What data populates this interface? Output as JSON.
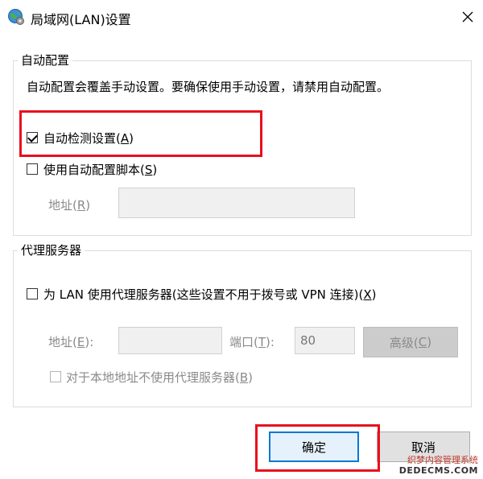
{
  "window": {
    "title": "局域网(LAN)设置",
    "icon": "globe-settings-icon"
  },
  "auto_config": {
    "legend": "自动配置",
    "description": "自动配置会覆盖手动设置。要确保使用手动设置，请禁用自动配置。",
    "auto_detect": {
      "prefix": "自动检测设置(",
      "key": "A",
      "suffix": ")",
      "checked": true
    },
    "use_script": {
      "prefix": "使用自动配置脚本(",
      "key": "S",
      "suffix": ")",
      "checked": false
    },
    "address": {
      "prefix": "地址(",
      "key": "R",
      "suffix": ")",
      "value": ""
    }
  },
  "proxy": {
    "legend": "代理服务器",
    "use_proxy": {
      "prefix": "为 LAN 使用代理服务器(这些设置不用于拨号或 VPN 连接)(",
      "key": "X",
      "suffix": ")",
      "checked": false
    },
    "address": {
      "prefix": "地址(",
      "key": "E",
      "suffix": "):",
      "value": ""
    },
    "port": {
      "prefix": "端口(",
      "key": "T",
      "suffix": "):",
      "value": "80"
    },
    "advanced": {
      "prefix": "高级(",
      "key": "C",
      "suffix": ")"
    },
    "bypass_local": {
      "prefix": "对于本地地址不使用代理服务器(",
      "key": "B",
      "suffix": ")",
      "checked": false
    }
  },
  "buttons": {
    "ok": "确定",
    "cancel": "取消"
  },
  "watermark": {
    "line1": "织梦内容管理系统",
    "line2": "DEDECMS.COM"
  },
  "colors": {
    "highlight": "#e8101e",
    "ok_border": "#0078d7"
  }
}
